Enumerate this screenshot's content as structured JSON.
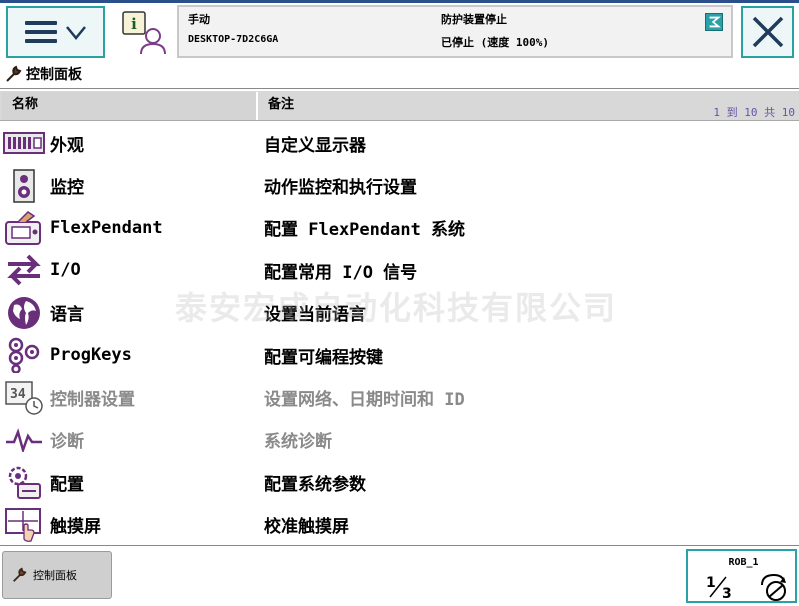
{
  "header": {
    "mode": "手动",
    "host": "DESKTOP-7D2C6GA",
    "guard_status": "防护装置停止",
    "run_state": "已停止 (速度 100%)"
  },
  "page": {
    "title": "控制面板"
  },
  "table": {
    "col_name": "名称",
    "col_note": "备注",
    "count": "1 到 10 共 10",
    "rows": [
      {
        "name": "外观",
        "note": "自定义显示器",
        "icon": "appearance-icon",
        "enabled": true
      },
      {
        "name": "监控",
        "note": "动作监控和执行设置",
        "icon": "supervision-icon",
        "enabled": true
      },
      {
        "name": "FlexPendant",
        "note": "配置 FlexPendant 系统",
        "icon": "flexpendant-icon",
        "enabled": true
      },
      {
        "name": "I/O",
        "note": "配置常用 I/O 信号",
        "icon": "io-arrows-icon",
        "enabled": true
      },
      {
        "name": "语言",
        "note": "设置当前语言",
        "icon": "globe-icon",
        "enabled": true
      },
      {
        "name": "ProgKeys",
        "note": "配置可编程按键",
        "icon": "progkeys-icon",
        "enabled": true
      },
      {
        "name": "控制器设置",
        "note": "设置网络、日期时间和 ID",
        "icon": "controller-settings-icon",
        "enabled": false
      },
      {
        "name": "诊断",
        "note": "系统诊断",
        "icon": "diagnostics-icon",
        "enabled": false
      },
      {
        "name": "配置",
        "note": "配置系统参数",
        "icon": "configuration-icon",
        "enabled": true
      },
      {
        "name": "触摸屏",
        "note": "校准触摸屏",
        "icon": "touchscreen-icon",
        "enabled": true
      }
    ]
  },
  "watermark": "泰安宏成自动化科技有限公司",
  "footer": {
    "task_label": "控制面板",
    "robot": "ROB_1"
  },
  "colors": {
    "accent": "#2aa0a8",
    "disabled": "#8a8a8a",
    "header_bg": "#d8d8d8"
  }
}
